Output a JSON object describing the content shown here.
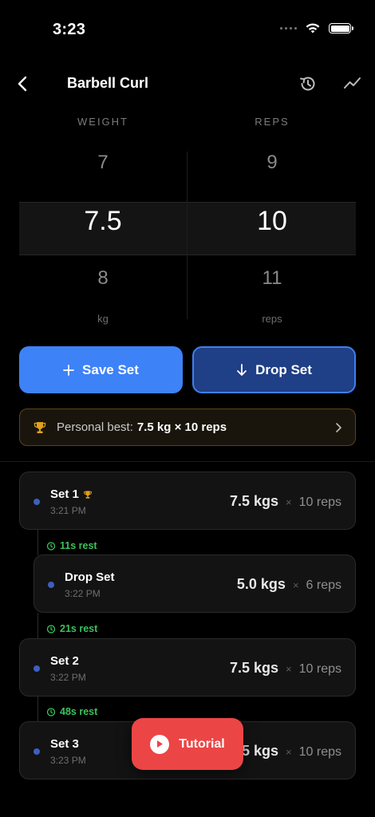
{
  "status_bar": {
    "time": "3:23"
  },
  "header": {
    "title": "Barbell Curl"
  },
  "picker": {
    "weight_label": "WEIGHT",
    "reps_label": "REPS",
    "weight": {
      "above": "7",
      "selected": "7.5",
      "below": "8",
      "unit": "kg"
    },
    "reps": {
      "above": "9",
      "selected": "10",
      "below": "11",
      "unit": "reps"
    }
  },
  "actions": {
    "save_label": "Save Set",
    "drop_label": "Drop Set"
  },
  "personal_best": {
    "label": "Personal best:",
    "value": "7.5 kg × 10 reps"
  },
  "sets": [
    {
      "name": "Set 1",
      "time": "3:21 PM",
      "weight": "7.5 kgs",
      "times": "×",
      "reps": "10 reps"
    },
    {
      "name": "Drop Set",
      "time": "3:22 PM",
      "weight": "5.0 kgs",
      "times": "×",
      "reps": "6 reps"
    },
    {
      "name": "Set 2",
      "time": "3:22 PM",
      "weight": "7.5 kgs",
      "times": "×",
      "reps": "10 reps"
    },
    {
      "name": "Set 3",
      "time": "3:23 PM",
      "weight": "7.5 kgs",
      "times": "×",
      "reps": "10 reps"
    }
  ],
  "rests": [
    "11s rest",
    "21s rest",
    "48s rest"
  ],
  "tutorial": {
    "label": "Tutorial"
  },
  "colors": {
    "accent": "#3d82f7",
    "drop": "#1f3f86",
    "rest": "#3cc25b",
    "tutorial": "#ec4545",
    "trophy": "#e0a11b"
  }
}
